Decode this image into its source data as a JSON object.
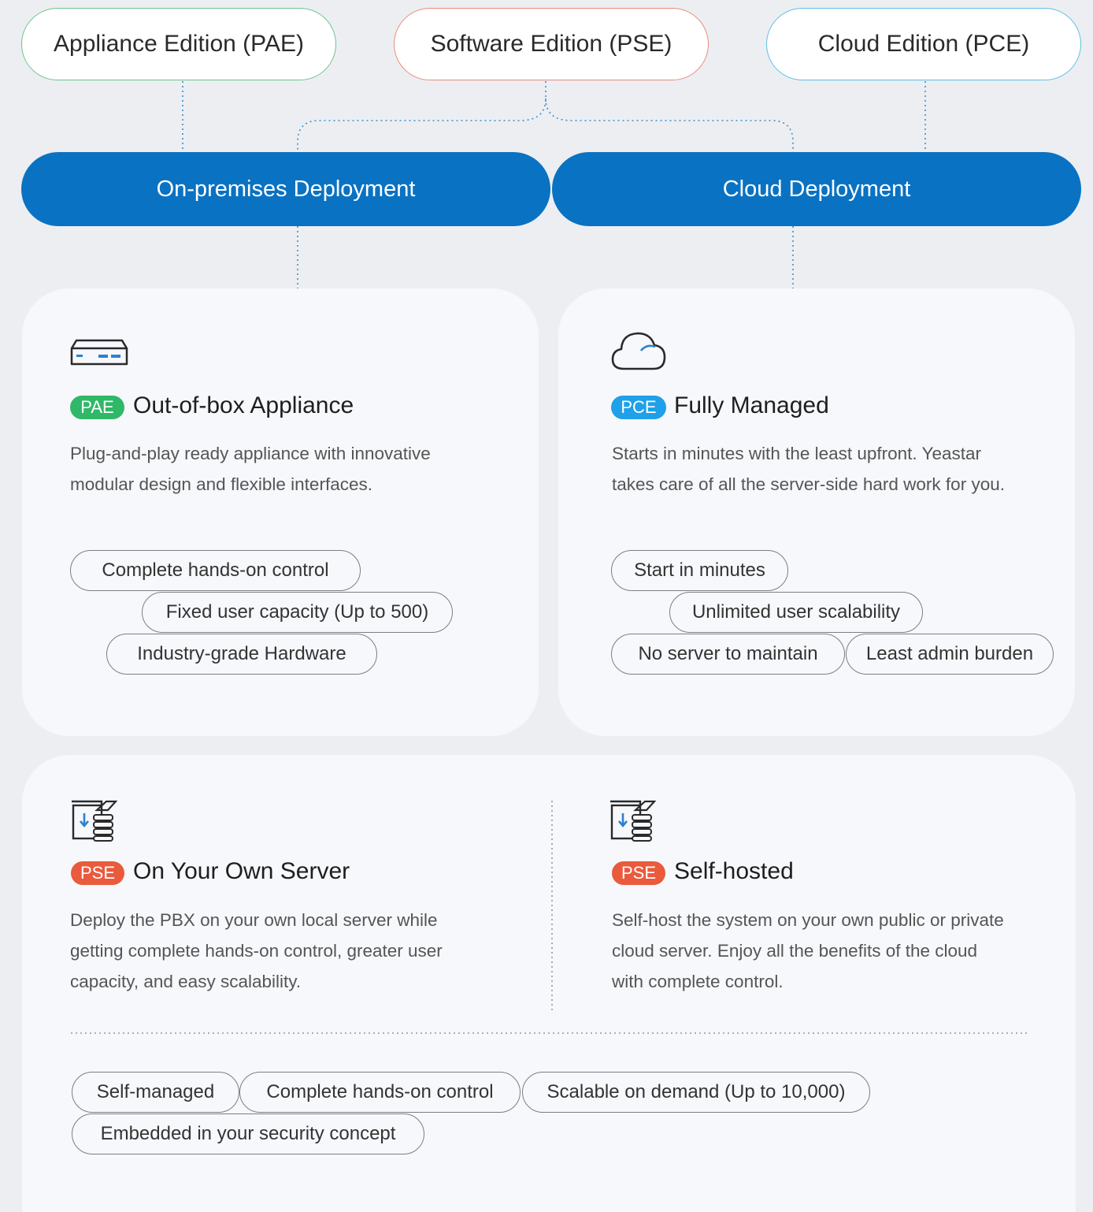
{
  "editions": {
    "pae": "Appliance Edition (PAE)",
    "pse": "Software Edition (PSE)",
    "pce": "Cloud Edition (PCE)"
  },
  "deployments": {
    "on_premises": "On-premises Deployment",
    "cloud": "Cloud Deployment"
  },
  "cards": {
    "appliance": {
      "icon": "appliance-icon",
      "badge": "PAE",
      "title": "Out-of-box Appliance",
      "desc_lines": [
        "Plug-and-play ready appliance with innovative",
        "modular design and flexible interfaces."
      ],
      "tags": [
        "Complete hands-on control",
        "Fixed user capacity (Up to 500)",
        "Industry-grade Hardware"
      ]
    },
    "managed": {
      "icon": "cloud-icon",
      "badge": "PCE",
      "title": "Fully Managed",
      "desc_lines": [
        "Starts in minutes with the least upfront. Yeastar",
        "takes care of all the server-side hard work for you."
      ],
      "tags": [
        "Start in minutes",
        "Unlimited user scalability",
        "No server to maintain",
        "Least admin burden"
      ]
    },
    "own_server": {
      "icon": "server-icon",
      "badge": "PSE",
      "title": "On Your Own Server",
      "desc_lines": [
        "Deploy the PBX on your own local server while",
        "getting complete hands-on control, greater user",
        "capacity, and easy scalability."
      ]
    },
    "self_hosted": {
      "icon": "server-icon",
      "badge": "PSE",
      "title": "Self-hosted",
      "desc_lines": [
        "Self-host the system on your own public or private",
        "cloud server. Enjoy all the benefits of the cloud",
        "with complete control."
      ]
    },
    "pse_tags": [
      "Self-managed",
      "Complete hands-on control",
      "Scalable on demand (Up to 10,000)",
      "Embedded in your security concept"
    ]
  },
  "colors": {
    "deploy_blue": "#0a72c2",
    "pae_green": "#2fb868",
    "pce_blue": "#1fa0e8",
    "pse_red": "#ea5a3c"
  }
}
